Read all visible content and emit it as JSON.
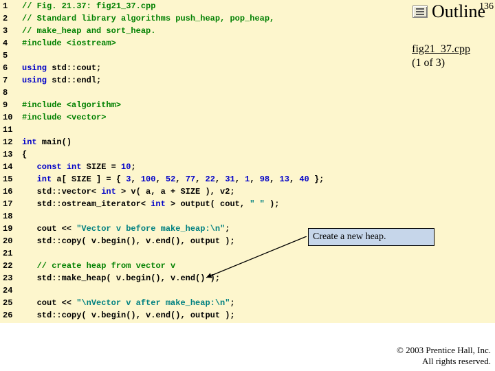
{
  "page_number": "136",
  "outline_label": "Outline",
  "file_label": {
    "name": "fig21_37.cpp",
    "part": "(1 of 3)"
  },
  "annotation": "Create a new heap.",
  "footer": {
    "l1": "© 2003 Prentice Hall, Inc.",
    "l2": "All rights reserved."
  },
  "code": [
    {
      "n": "1",
      "segs": [
        {
          "c": "cm",
          "t": "// Fig. 21.37: fig21_37.cpp"
        }
      ]
    },
    {
      "n": "2",
      "segs": [
        {
          "c": "cm",
          "t": "// Standard library algorithms push_heap, pop_heap,"
        }
      ]
    },
    {
      "n": "3",
      "segs": [
        {
          "c": "cm",
          "t": "// make_heap and sort_heap."
        }
      ]
    },
    {
      "n": "4",
      "segs": [
        {
          "c": "pp",
          "t": "#include <iostream>"
        }
      ]
    },
    {
      "n": "5",
      "segs": [
        {
          "c": "plain",
          "t": ""
        }
      ]
    },
    {
      "n": "6",
      "segs": [
        {
          "c": "kw",
          "t": "using"
        },
        {
          "c": "plain",
          "t": " std::cout;"
        }
      ]
    },
    {
      "n": "7",
      "segs": [
        {
          "c": "kw",
          "t": "using"
        },
        {
          "c": "plain",
          "t": " std::endl;"
        }
      ]
    },
    {
      "n": "8",
      "segs": [
        {
          "c": "plain",
          "t": ""
        }
      ]
    },
    {
      "n": "9",
      "segs": [
        {
          "c": "pp",
          "t": "#include <algorithm>"
        }
      ]
    },
    {
      "n": "10",
      "segs": [
        {
          "c": "pp",
          "t": "#include <vector>"
        }
      ]
    },
    {
      "n": "11",
      "segs": [
        {
          "c": "plain",
          "t": ""
        }
      ]
    },
    {
      "n": "12",
      "segs": [
        {
          "c": "kw",
          "t": "int"
        },
        {
          "c": "plain",
          "t": " main()"
        }
      ]
    },
    {
      "n": "13",
      "segs": [
        {
          "c": "plain",
          "t": "{"
        }
      ]
    },
    {
      "n": "14",
      "segs": [
        {
          "c": "plain",
          "t": "   "
        },
        {
          "c": "kw",
          "t": "const int"
        },
        {
          "c": "plain",
          "t": " SIZE = "
        },
        {
          "c": "kw",
          "t": "10"
        },
        {
          "c": "plain",
          "t": ";"
        }
      ]
    },
    {
      "n": "15",
      "segs": [
        {
          "c": "plain",
          "t": "   "
        },
        {
          "c": "kw",
          "t": "int"
        },
        {
          "c": "plain",
          "t": " a[ SIZE ] = { "
        },
        {
          "c": "kw",
          "t": "3"
        },
        {
          "c": "plain",
          "t": ", "
        },
        {
          "c": "kw",
          "t": "100"
        },
        {
          "c": "plain",
          "t": ", "
        },
        {
          "c": "kw",
          "t": "52"
        },
        {
          "c": "plain",
          "t": ", "
        },
        {
          "c": "kw",
          "t": "77"
        },
        {
          "c": "plain",
          "t": ", "
        },
        {
          "c": "kw",
          "t": "22"
        },
        {
          "c": "plain",
          "t": ", "
        },
        {
          "c": "kw",
          "t": "31"
        },
        {
          "c": "plain",
          "t": ", "
        },
        {
          "c": "kw",
          "t": "1"
        },
        {
          "c": "plain",
          "t": ", "
        },
        {
          "c": "kw",
          "t": "98"
        },
        {
          "c": "plain",
          "t": ", "
        },
        {
          "c": "kw",
          "t": "13"
        },
        {
          "c": "plain",
          "t": ", "
        },
        {
          "c": "kw",
          "t": "40"
        },
        {
          "c": "plain",
          "t": " };"
        }
      ]
    },
    {
      "n": "16",
      "segs": [
        {
          "c": "plain",
          "t": "   std::vector< "
        },
        {
          "c": "kw",
          "t": "int"
        },
        {
          "c": "plain",
          "t": " > v( a, a + SIZE ), v2;"
        }
      ]
    },
    {
      "n": "17",
      "segs": [
        {
          "c": "plain",
          "t": "   std::ostream_iterator< "
        },
        {
          "c": "kw",
          "t": "int"
        },
        {
          "c": "plain",
          "t": " > output( cout, "
        },
        {
          "c": "str",
          "t": "\" \""
        },
        {
          "c": "plain",
          "t": " );"
        }
      ]
    },
    {
      "n": "18",
      "segs": [
        {
          "c": "plain",
          "t": ""
        }
      ]
    },
    {
      "n": "19",
      "segs": [
        {
          "c": "plain",
          "t": "   cout << "
        },
        {
          "c": "str",
          "t": "\"Vector v before make_heap:\\n\""
        },
        {
          "c": "plain",
          "t": ";"
        }
      ]
    },
    {
      "n": "20",
      "segs": [
        {
          "c": "plain",
          "t": "   std::copy( v.begin(), v.end(), output );"
        }
      ]
    },
    {
      "n": "21",
      "segs": [
        {
          "c": "plain",
          "t": ""
        }
      ]
    },
    {
      "n": "22",
      "segs": [
        {
          "c": "plain",
          "t": "   "
        },
        {
          "c": "cm",
          "t": "// create heap from vector v"
        }
      ]
    },
    {
      "n": "23",
      "segs": [
        {
          "c": "plain",
          "t": "   std::make_heap( v.begin(), v.end() );"
        }
      ]
    },
    {
      "n": "24",
      "segs": [
        {
          "c": "plain",
          "t": ""
        }
      ]
    },
    {
      "n": "25",
      "segs": [
        {
          "c": "plain",
          "t": "   cout << "
        },
        {
          "c": "str",
          "t": "\"\\nVector v after make_heap:\\n\""
        },
        {
          "c": "plain",
          "t": ";"
        }
      ]
    },
    {
      "n": "26",
      "segs": [
        {
          "c": "plain",
          "t": "   std::copy( v.begin(), v.end(), output );"
        }
      ]
    }
  ]
}
